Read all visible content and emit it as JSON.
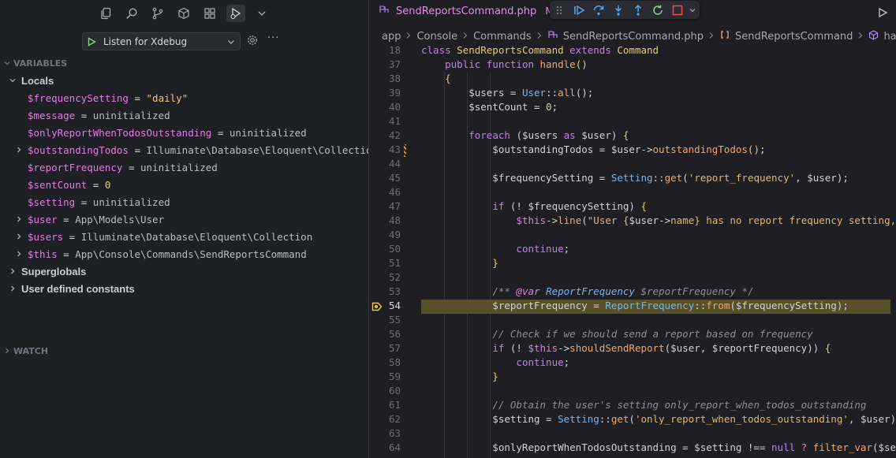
{
  "debug_sidebar": {
    "launch_config": "Listen for Xdebug",
    "more": "···",
    "sections": {
      "variables": "VARIABLES",
      "watch": "WATCH"
    },
    "variables": [
      {
        "label": "Locals",
        "group": true,
        "expanded": true
      },
      {
        "name": "$frequencySetting",
        "eq": " = ",
        "value": "\"daily\"",
        "kind": "string"
      },
      {
        "name": "$message",
        "eq": " = ",
        "value": "uninitialized",
        "kind": "plain"
      },
      {
        "name": "$onlyReportWhenTodosOutstanding",
        "eq": " = ",
        "value": "uninitialized",
        "kind": "plain"
      },
      {
        "name": "$outstandingTodos",
        "eq": " = ",
        "value": "Illuminate\\Database\\Eloquent\\Collection",
        "kind": "plain",
        "expandable": true
      },
      {
        "name": "$reportFrequency",
        "eq": " = ",
        "value": "uninitialized",
        "kind": "plain"
      },
      {
        "name": "$sentCount",
        "eq": " = ",
        "value": "0",
        "kind": "number"
      },
      {
        "name": "$setting",
        "eq": " = ",
        "value": "uninitialized",
        "kind": "plain"
      },
      {
        "name": "$user",
        "eq": " = ",
        "value": "App\\Models\\User",
        "kind": "plain",
        "expandable": true
      },
      {
        "name": "$users",
        "eq": " = ",
        "value": "Illuminate\\Database\\Eloquent\\Collection",
        "kind": "plain",
        "expandable": true
      },
      {
        "name": "$this",
        "eq": " = ",
        "value": "App\\Console\\Commands\\SendReportsCommand",
        "kind": "plain",
        "expandable": true
      },
      {
        "label": "Superglobals",
        "group": true,
        "expanded": false
      },
      {
        "label": "User defined constants",
        "group": true,
        "expanded": false
      }
    ]
  },
  "editor": {
    "tab": {
      "filename": "SendReportsCommand.php",
      "modified": "M"
    },
    "breadcrumbs": [
      "app",
      "Console",
      "Commands",
      "SendReportsCommand.php",
      "SendReportsCommand",
      "handle"
    ],
    "colors": {
      "current_line": "#585028",
      "breakpoint": "#f0c43c"
    }
  },
  "code_lines": [
    {
      "n": "18",
      "tokens": [
        [
          "k",
          "class "
        ],
        [
          "c",
          "SendReportsCommand "
        ],
        [
          "k",
          "extends "
        ],
        [
          "c",
          "Command"
        ]
      ]
    },
    {
      "n": "37",
      "tokens": [
        [
          "v",
          "    "
        ],
        [
          "k",
          "public function "
        ],
        [
          "f",
          "handle"
        ],
        [
          "c",
          "()"
        ]
      ]
    },
    {
      "n": "38",
      "tokens": [
        [
          "c",
          "    {"
        ]
      ]
    },
    {
      "n": "39",
      "tokens": [
        [
          "v",
          "        $users = "
        ],
        [
          "t",
          "User"
        ],
        [
          "v",
          "::"
        ],
        [
          "f",
          "all"
        ],
        [
          "v",
          "();"
        ]
      ]
    },
    {
      "n": "40",
      "tokens": [
        [
          "v",
          "        $sentCount = "
        ],
        [
          "n",
          "0"
        ],
        [
          "v",
          ";"
        ]
      ]
    },
    {
      "n": "41",
      "tokens": []
    },
    {
      "n": "42",
      "tokens": [
        [
          "v",
          "        "
        ],
        [
          "k",
          "foreach "
        ],
        [
          "v",
          "($users "
        ],
        [
          "k",
          "as "
        ],
        [
          "v",
          "$user) "
        ],
        [
          "c",
          "{"
        ]
      ]
    },
    {
      "n": "43",
      "tokens": [
        [
          "v",
          "            $outstandingTodos = $user->"
        ],
        [
          "f",
          "outstandingTodos"
        ],
        [
          "c",
          "()"
        ],
        [
          "v",
          ";"
        ]
      ]
    },
    {
      "n": "44",
      "tokens": []
    },
    {
      "n": "45",
      "tokens": [
        [
          "v",
          "            $frequencySetting = "
        ],
        [
          "t",
          "Setting"
        ],
        [
          "v",
          "::"
        ],
        [
          "f",
          "get"
        ],
        [
          "v",
          "("
        ],
        [
          "s",
          "'report_frequency'"
        ],
        [
          "v",
          ", $user);"
        ]
      ]
    },
    {
      "n": "46",
      "tokens": []
    },
    {
      "n": "47",
      "tokens": [
        [
          "v",
          "            "
        ],
        [
          "k",
          "if "
        ],
        [
          "v",
          "(! $frequencySetting) "
        ],
        [
          "c",
          "{"
        ]
      ]
    },
    {
      "n": "48",
      "tokens": [
        [
          "v",
          "                "
        ],
        [
          "op",
          "$this"
        ],
        [
          "v",
          "->"
        ],
        [
          "f",
          "line"
        ],
        [
          "v",
          "("
        ],
        [
          "s",
          "\"User {"
        ],
        [
          "v",
          "$user->"
        ],
        [
          "s",
          "name} has no report frequency setting, sl"
        ]
      ]
    },
    {
      "n": "49",
      "tokens": []
    },
    {
      "n": "50",
      "tokens": [
        [
          "v",
          "                "
        ],
        [
          "k",
          "continue"
        ],
        [
          "v",
          ";"
        ]
      ]
    },
    {
      "n": "51",
      "tokens": [
        [
          "c",
          "            }"
        ]
      ]
    },
    {
      "n": "52",
      "tokens": []
    },
    {
      "n": "53",
      "tokens": [
        [
          "v",
          "            "
        ],
        [
          "cm",
          "/** "
        ],
        [
          "cmk",
          "@var "
        ],
        [
          "cmt",
          "ReportFrequency "
        ],
        [
          "cm",
          "$reportFrequency */"
        ]
      ]
    },
    {
      "n": "54",
      "tokens": [
        [
          "v",
          "            $reportFrequency = "
        ],
        [
          "t",
          "ReportFrequency"
        ],
        [
          "v",
          "::"
        ],
        [
          "f",
          "from"
        ],
        [
          "v",
          "($frequencySetting);"
        ]
      ],
      "current": true,
      "breakpoint": true
    },
    {
      "n": "55",
      "tokens": []
    },
    {
      "n": "56",
      "tokens": [
        [
          "v",
          "            "
        ],
        [
          "cm",
          "// Check if we should send a report based on frequency"
        ]
      ]
    },
    {
      "n": "57",
      "tokens": [
        [
          "v",
          "            "
        ],
        [
          "k",
          "if "
        ],
        [
          "v",
          "(! "
        ],
        [
          "op",
          "$this"
        ],
        [
          "v",
          "->"
        ],
        [
          "f",
          "shouldSendReport"
        ],
        [
          "v",
          "($user, $reportFrequency)) "
        ],
        [
          "c",
          "{"
        ]
      ]
    },
    {
      "n": "58",
      "tokens": [
        [
          "v",
          "                "
        ],
        [
          "k",
          "continue"
        ],
        [
          "v",
          ";"
        ]
      ]
    },
    {
      "n": "59",
      "tokens": [
        [
          "c",
          "            }"
        ]
      ]
    },
    {
      "n": "60",
      "tokens": []
    },
    {
      "n": "61",
      "tokens": [
        [
          "v",
          "            "
        ],
        [
          "cm",
          "// Obtain the user's setting only_report_when_todos_outstanding"
        ]
      ]
    },
    {
      "n": "62",
      "tokens": [
        [
          "v",
          "            $setting = "
        ],
        [
          "t",
          "Setting"
        ],
        [
          "v",
          "::"
        ],
        [
          "f",
          "get"
        ],
        [
          "v",
          "("
        ],
        [
          "s",
          "'only_report_when_todos_outstanding'"
        ],
        [
          "v",
          ", $user);"
        ]
      ]
    },
    {
      "n": "63",
      "tokens": []
    },
    {
      "n": "64",
      "tokens": [
        [
          "v",
          "            $onlyReportWhenTodosOutstanding = $setting !== "
        ],
        [
          "k",
          "null "
        ],
        [
          "op",
          "? "
        ],
        [
          "f",
          "filter_var"
        ],
        [
          "v",
          "($setti"
        ]
      ]
    }
  ]
}
